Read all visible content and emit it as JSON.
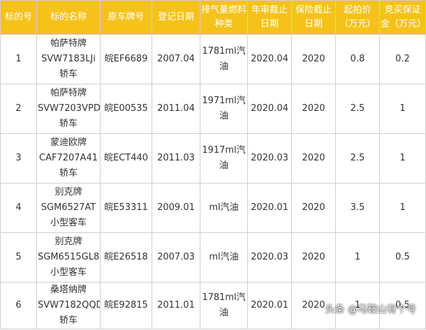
{
  "table": {
    "headers": [
      "标的号",
      "标的名称",
      "原车牌号",
      "登记日期",
      "排气量燃料种类",
      "年审截止日期",
      "保险截止日期",
      "起拍价（万元）",
      "竞买保证金（万元）"
    ],
    "rows": [
      [
        "1",
        "帕萨特牌SVW7183LJi轿车",
        "皖EF6689",
        "2007.04",
        "1781ml汽油",
        "2020.04",
        "2020",
        "0.8",
        "0.2"
      ],
      [
        "2",
        "帕萨特牌SVW7203VPD轿车",
        "皖E00535",
        "2011.04",
        "1971ml汽油",
        "2020.04",
        "2020",
        "2.5",
        "1"
      ],
      [
        "3",
        "蒙迪欧牌CAF7207A41轿车",
        "皖ECT440",
        "2011.03",
        "1917ml汽油",
        "2020.03",
        "2020",
        "2.5",
        "1"
      ],
      [
        "4",
        "别克牌SGM6527AT小型客车",
        "皖E53311",
        "2009.01",
        "ml汽油",
        "2020.01",
        "2020",
        "3.5",
        "1"
      ],
      [
        "5",
        "别克牌SGM6515GL8 小型客车",
        "皖E26518",
        "2007.03",
        "ml汽油",
        "2020.03",
        "2020",
        "1",
        "0.5"
      ],
      [
        "6",
        "桑塔纳牌SVW7182QQD轿车",
        "皖E92815",
        "2011.01",
        "1781ml汽油",
        "2020.01",
        "2020",
        "1",
        "0.5"
      ]
    ]
  },
  "watermark": "头条 @马鞍山有个号",
  "colors": {
    "header_bg": "#f5c21a",
    "header_text": "#ffffff",
    "border": "#cfcfcf"
  }
}
